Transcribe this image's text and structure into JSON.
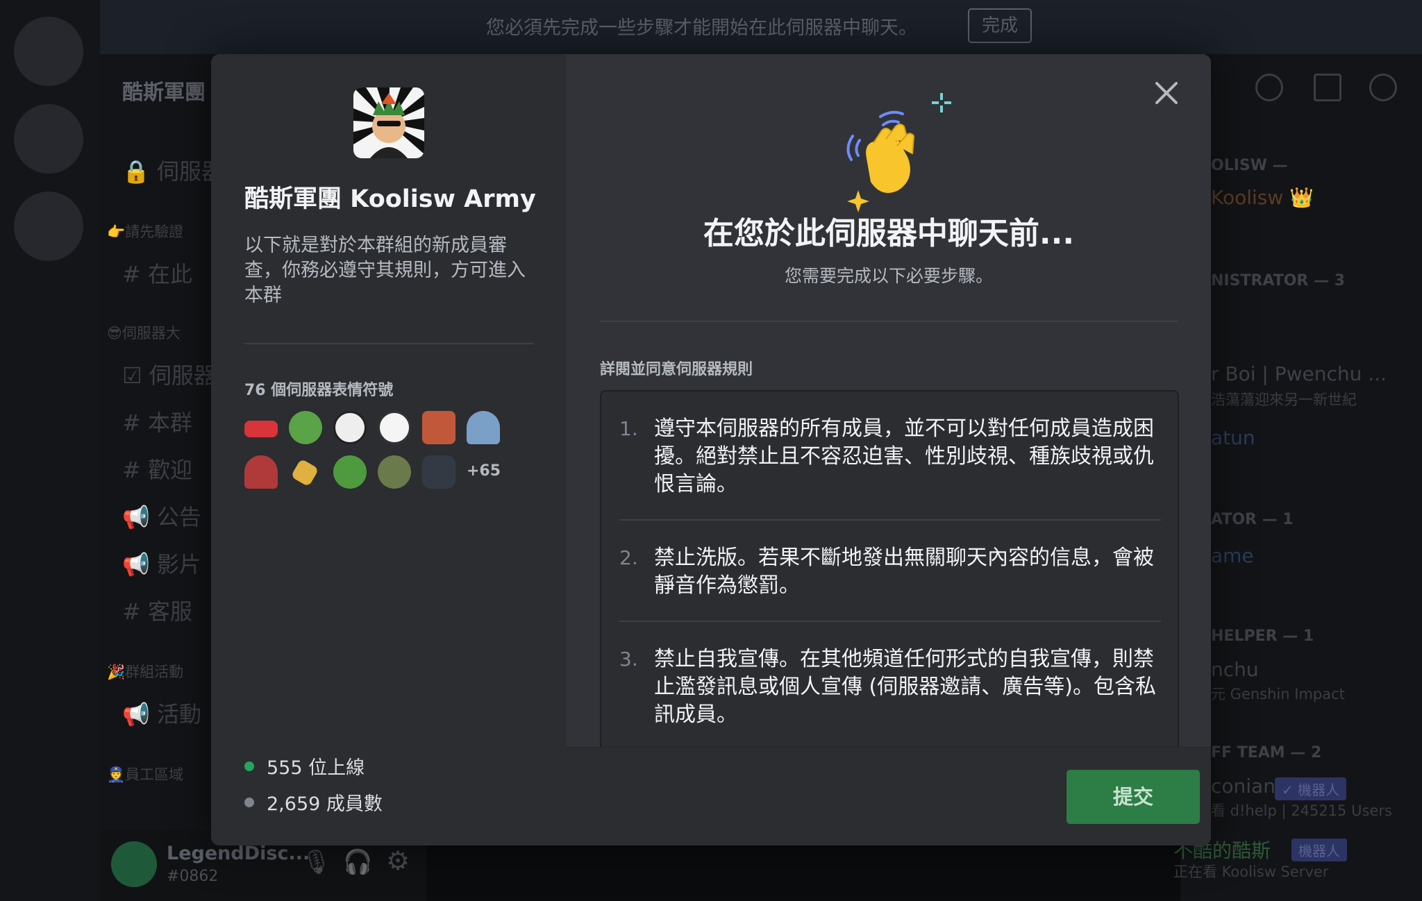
{
  "background": {
    "notice": {
      "text": "您必須先完成一些步驟才能開始在此伺服器中聊天。",
      "button": "完成"
    },
    "server_name": "酷斯軍團",
    "channels": [
      {
        "icon": "lock-icon",
        "label": "伺服器"
      },
      {
        "icon": "hash-icon",
        "label": "在此"
      },
      {
        "icon": "checkbox-icon",
        "label": "伺服器"
      },
      {
        "icon": "hash-icon",
        "label": "本群"
      },
      {
        "icon": "hash-icon",
        "label": "歡迎"
      },
      {
        "icon": "megaphone-icon",
        "label": "公告"
      },
      {
        "icon": "megaphone-icon",
        "label": "影片"
      },
      {
        "icon": "hash-icon",
        "label": "客服"
      },
      {
        "icon": "megaphone-icon",
        "label": "活動"
      }
    ],
    "categories": [
      "👉請先驗證",
      "😎伺服器大",
      "🎉群組活動",
      "👮員工區域"
    ],
    "user": {
      "name": "LegendDisc...",
      "tag": "#0862"
    },
    "members": [
      {
        "type": "head",
        "text": "OLISW —"
      },
      {
        "type": "name",
        "text": "Koolisw 👑"
      },
      {
        "type": "head",
        "text": "NISTRATOR — 3"
      },
      {
        "type": "name",
        "text": "r Boi | Pwenchu ..."
      },
      {
        "type": "sub",
        "text": "浩蕩蕩迎來另一新世紀"
      },
      {
        "type": "name",
        "text": "atun"
      },
      {
        "type": "head",
        "text": "ATOR — 1"
      },
      {
        "type": "name",
        "text": "ame"
      },
      {
        "type": "head",
        "text": "HELPER — 1"
      },
      {
        "type": "name",
        "text": "nchu"
      },
      {
        "type": "sub",
        "text": "元 Genshin Impact"
      },
      {
        "type": "head",
        "text": "FF TEAM — 2"
      },
      {
        "type": "name",
        "text": "conian"
      },
      {
        "type": "sub",
        "text": "看 d!help | 245215 Users"
      },
      {
        "type": "name",
        "text": "不酷的酷斯"
      },
      {
        "type": "sub",
        "text": "正在看 Koolisw Server"
      }
    ],
    "bot_badge": "✓ 機器人",
    "bot_badge2": "機器人"
  },
  "modal": {
    "server_title": "酷斯軍團 Koolisw Army",
    "server_desc": "以下就是對於本群組的新成員審查，你務必遵守其規則，方可進入本群",
    "emoji_count": "76 個伺服器表情符號",
    "emoji_more": "+65",
    "online": "555 位上線",
    "members": "2,659 成員數",
    "title": "在您於此伺服器中聊天前...",
    "subtitle": "您需要完成以下必要步驟。",
    "rules_label": "詳閱並同意伺服器規則",
    "rules": [
      {
        "num": "1.",
        "text": "遵守本伺服器的所有成員，並不可以對任何成員造成困擾。絕對禁止且不容忍迫害、性別歧視、種族歧視或仇恨言論。"
      },
      {
        "num": "2.",
        "text": "禁止洗版。若果不斷地發出無關聊天內容的信息，會被靜音作為懲罰。"
      },
      {
        "num": "3.",
        "text": "禁止自我宣傳。在其他頻道任何形式的自我宣傳，則禁止濫發訊息或個人宣傳 (伺服器邀請、廣告等)。包含私訊成員。"
      }
    ],
    "submit": "提交"
  },
  "colors": {
    "accent_green": "#2d7d46",
    "online_dot": "#23a55a",
    "offline_dot": "#80848e"
  }
}
